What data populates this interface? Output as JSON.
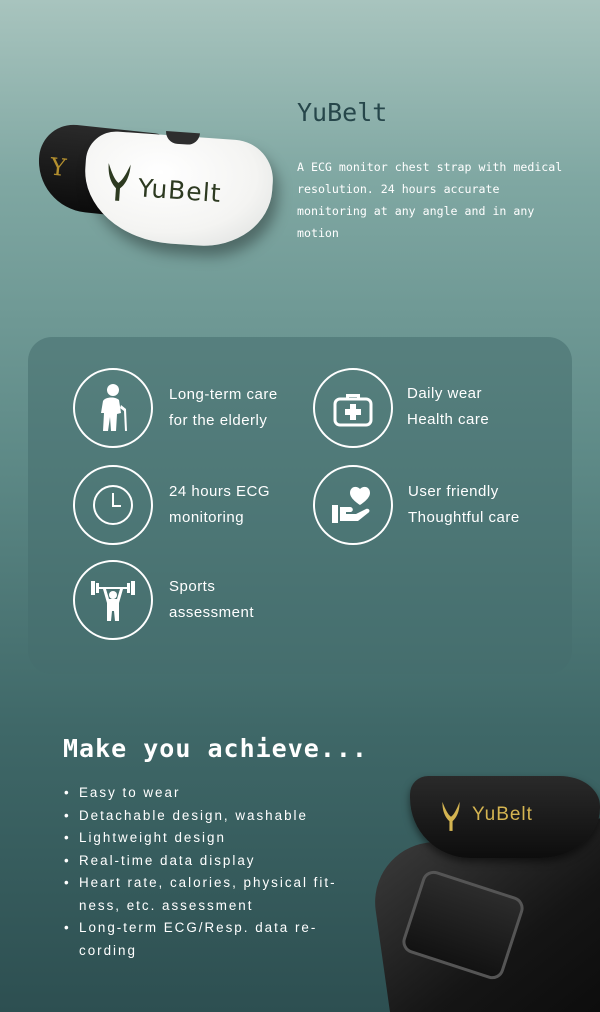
{
  "hero": {
    "title": "YuBelt",
    "description": "A ECG monitor chest strap with medical resolution. 24 hours accurate monitoring at any angle and in any motion",
    "product_brand": "YuBelt"
  },
  "features": [
    {
      "icon": "elderly-person-icon",
      "line1": "Long-term care",
      "line2": "for the elderly"
    },
    {
      "icon": "medical-kit-icon",
      "line1": "Daily wear",
      "line2": "Health care"
    },
    {
      "icon": "clock-icon",
      "line1": "24 hours ECG",
      "line2": "monitoring"
    },
    {
      "icon": "heart-hand-icon",
      "line1": "User friendly",
      "line2": "Thoughtful care"
    },
    {
      "icon": "weightlifter-icon",
      "line1": "Sports",
      "line2": "assessment"
    }
  ],
  "achieve": {
    "title": "Make you achieve...",
    "items": [
      "Easy to wear",
      "Detachable design, washable",
      "Lightweight design",
      "Real-time data display",
      "Heart rate, calories, physical fit-ness, etc. assessment",
      "Long-term ECG/Resp. data re-cording"
    ]
  },
  "colors": {
    "title_teal": "#26464a",
    "brand_gold": "#d4b451",
    "logo_green": "#2d3a21"
  }
}
